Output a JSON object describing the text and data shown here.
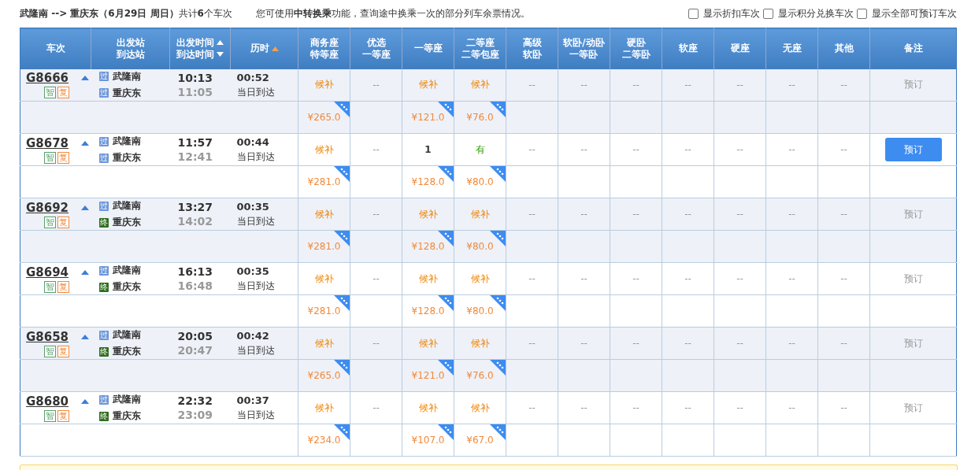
{
  "summary": "**武隆南 --> 重庆东（6月29日  周日）**共计**6**个车次",
  "notice": "您可使用**中转换乘**功能，查询途中换乘一次的部分列车余票情况。",
  "filters": [
    {
      "label": "显示折扣车次",
      "checked": false
    },
    {
      "label": "显示积分兑换车次",
      "checked": false
    },
    {
      "label": "显示全部可预订车次",
      "checked": false
    }
  ],
  "columns": [
    {
      "lines": [
        "车次"
      ],
      "kind": "plain"
    },
    {
      "lines": [
        "出发站",
        "到达站"
      ],
      "kind": "plain"
    },
    {
      "lines": [
        "出发时间",
        "到达时间"
      ],
      "kind": "twoway"
    },
    {
      "lines": [
        "历时"
      ],
      "kind": "sorted"
    },
    {
      "lines": [
        "商务座",
        "特等座"
      ],
      "kind": "plain"
    },
    {
      "lines": [
        "优选",
        "一等座"
      ],
      "kind": "plain"
    },
    {
      "lines": [
        "一等座"
      ],
      "kind": "plain"
    },
    {
      "lines": [
        "二等座",
        "二等包座"
      ],
      "kind": "plain"
    },
    {
      "lines": [
        "高级",
        "软卧"
      ],
      "kind": "plain"
    },
    {
      "lines": [
        "软卧/动卧",
        "一等卧"
      ],
      "kind": "plain"
    },
    {
      "lines": [
        "硬卧",
        "二等卧"
      ],
      "kind": "plain"
    },
    {
      "lines": [
        "软座"
      ],
      "kind": "plain"
    },
    {
      "lines": [
        "硬座"
      ],
      "kind": "plain"
    },
    {
      "lines": [
        "无座"
      ],
      "kind": "plain"
    },
    {
      "lines": [
        "其他"
      ],
      "kind": "plain"
    },
    {
      "lines": [
        "备注"
      ],
      "kind": "plain"
    }
  ],
  "trains": [
    {
      "number": "G8666",
      "tags": [
        "智",
        "复"
      ],
      "from": {
        "badge": "过",
        "kind": "pass",
        "name": "武隆南"
      },
      "to": {
        "badge": "过",
        "kind": "pass",
        "name": "重庆东"
      },
      "depart": "10:13",
      "arrive": "11:05",
      "duration": "00:52",
      "arrival_day": "当日到达",
      "seats": [
        {
          "value": "候补",
          "kind": "waitlist",
          "price": "¥265.0"
        },
        {
          "value": "--",
          "kind": "none"
        },
        {
          "value": "候补",
          "kind": "waitlist",
          "price": "¥121.0"
        },
        {
          "value": "候补",
          "kind": "waitlist",
          "price": "¥76.0"
        },
        {
          "value": "--",
          "kind": "none"
        },
        {
          "value": "--",
          "kind": "none"
        },
        {
          "value": "--",
          "kind": "none"
        },
        {
          "value": "--",
          "kind": "none"
        },
        {
          "value": "--",
          "kind": "none"
        },
        {
          "value": "--",
          "kind": "none"
        },
        {
          "value": "--",
          "kind": "none"
        }
      ],
      "booking": {
        "label": "预订",
        "enabled": false
      }
    },
    {
      "number": "G8678",
      "tags": [
        "智",
        "复"
      ],
      "from": {
        "badge": "过",
        "kind": "pass",
        "name": "武隆南"
      },
      "to": {
        "badge": "过",
        "kind": "pass",
        "name": "重庆东"
      },
      "depart": "11:57",
      "arrive": "12:41",
      "duration": "00:44",
      "arrival_day": "当日到达",
      "seats": [
        {
          "value": "候补",
          "kind": "waitlist",
          "price": "¥281.0"
        },
        {
          "value": "--",
          "kind": "none"
        },
        {
          "value": "1",
          "kind": "count",
          "price": "¥128.0"
        },
        {
          "value": "有",
          "kind": "available",
          "price": "¥80.0"
        },
        {
          "value": "--",
          "kind": "none"
        },
        {
          "value": "--",
          "kind": "none"
        },
        {
          "value": "--",
          "kind": "none"
        },
        {
          "value": "--",
          "kind": "none"
        },
        {
          "value": "--",
          "kind": "none"
        },
        {
          "value": "--",
          "kind": "none"
        },
        {
          "value": "--",
          "kind": "none"
        }
      ],
      "booking": {
        "label": "预订",
        "enabled": true
      }
    },
    {
      "number": "G8692",
      "tags": [
        "智",
        "复"
      ],
      "from": {
        "badge": "过",
        "kind": "pass",
        "name": "武隆南"
      },
      "to": {
        "badge": "终",
        "kind": "end",
        "name": "重庆东"
      },
      "depart": "13:27",
      "arrive": "14:02",
      "duration": "00:35",
      "arrival_day": "当日到达",
      "seats": [
        {
          "value": "候补",
          "kind": "waitlist",
          "price": "¥281.0"
        },
        {
          "value": "--",
          "kind": "none"
        },
        {
          "value": "候补",
          "kind": "waitlist",
          "price": "¥128.0"
        },
        {
          "value": "候补",
          "kind": "waitlist",
          "price": "¥80.0"
        },
        {
          "value": "--",
          "kind": "none"
        },
        {
          "value": "--",
          "kind": "none"
        },
        {
          "value": "--",
          "kind": "none"
        },
        {
          "value": "--",
          "kind": "none"
        },
        {
          "value": "--",
          "kind": "none"
        },
        {
          "value": "--",
          "kind": "none"
        },
        {
          "value": "--",
          "kind": "none"
        }
      ],
      "booking": {
        "label": "预订",
        "enabled": false
      }
    },
    {
      "number": "G8694",
      "tags": [
        "智",
        "复"
      ],
      "from": {
        "badge": "过",
        "kind": "pass",
        "name": "武隆南"
      },
      "to": {
        "badge": "终",
        "kind": "end",
        "name": "重庆东"
      },
      "depart": "16:13",
      "arrive": "16:48",
      "duration": "00:35",
      "arrival_day": "当日到达",
      "seats": [
        {
          "value": "候补",
          "kind": "waitlist",
          "price": "¥281.0"
        },
        {
          "value": "--",
          "kind": "none"
        },
        {
          "value": "候补",
          "kind": "waitlist",
          "price": "¥128.0"
        },
        {
          "value": "候补",
          "kind": "waitlist",
          "price": "¥80.0"
        },
        {
          "value": "--",
          "kind": "none"
        },
        {
          "value": "--",
          "kind": "none"
        },
        {
          "value": "--",
          "kind": "none"
        },
        {
          "value": "--",
          "kind": "none"
        },
        {
          "value": "--",
          "kind": "none"
        },
        {
          "value": "--",
          "kind": "none"
        },
        {
          "value": "--",
          "kind": "none"
        }
      ],
      "booking": {
        "label": "预订",
        "enabled": false
      }
    },
    {
      "number": "G8658",
      "tags": [
        "智",
        "复"
      ],
      "from": {
        "badge": "过",
        "kind": "pass",
        "name": "武隆南"
      },
      "to": {
        "badge": "终",
        "kind": "end",
        "name": "重庆东"
      },
      "depart": "20:05",
      "arrive": "20:47",
      "duration": "00:42",
      "arrival_day": "当日到达",
      "seats": [
        {
          "value": "候补",
          "kind": "waitlist",
          "price": "¥265.0"
        },
        {
          "value": "--",
          "kind": "none"
        },
        {
          "value": "候补",
          "kind": "waitlist",
          "price": "¥121.0"
        },
        {
          "value": "候补",
          "kind": "waitlist",
          "price": "¥76.0"
        },
        {
          "value": "--",
          "kind": "none"
        },
        {
          "value": "--",
          "kind": "none"
        },
        {
          "value": "--",
          "kind": "none"
        },
        {
          "value": "--",
          "kind": "none"
        },
        {
          "value": "--",
          "kind": "none"
        },
        {
          "value": "--",
          "kind": "none"
        },
        {
          "value": "--",
          "kind": "none"
        }
      ],
      "booking": {
        "label": "预订",
        "enabled": false
      }
    },
    {
      "number": "G8680",
      "tags": [
        "智",
        "复"
      ],
      "from": {
        "badge": "过",
        "kind": "pass",
        "name": "武隆南"
      },
      "to": {
        "badge": "终",
        "kind": "end",
        "name": "重庆东"
      },
      "depart": "22:32",
      "arrive": "23:09",
      "duration": "00:37",
      "arrival_day": "当日到达",
      "seats": [
        {
          "value": "候补",
          "kind": "waitlist",
          "price": "¥234.0"
        },
        {
          "value": "--",
          "kind": "none"
        },
        {
          "value": "候补",
          "kind": "waitlist",
          "price": "¥107.0"
        },
        {
          "value": "候补",
          "kind": "waitlist",
          "price": "¥67.0"
        },
        {
          "value": "--",
          "kind": "none"
        },
        {
          "value": "--",
          "kind": "none"
        },
        {
          "value": "--",
          "kind": "none"
        },
        {
          "value": "--",
          "kind": "none"
        },
        {
          "value": "--",
          "kind": "none"
        },
        {
          "value": "--",
          "kind": "none"
        },
        {
          "value": "--",
          "kind": "none"
        }
      ],
      "booking": {
        "label": "预订",
        "enabled": false
      }
    }
  ]
}
